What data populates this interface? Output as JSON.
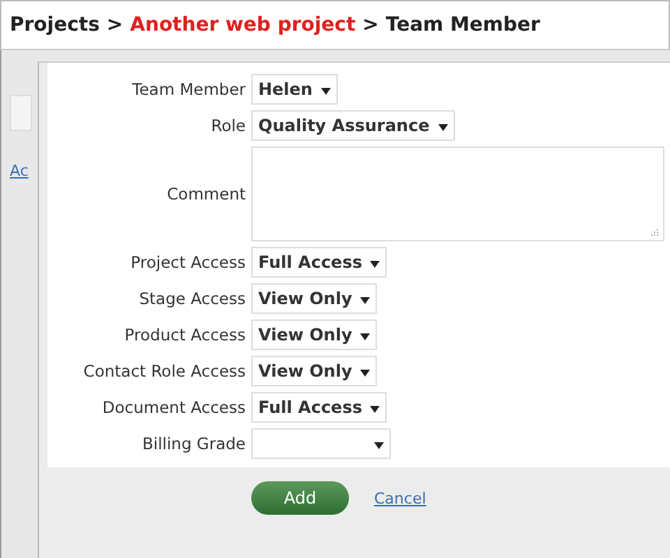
{
  "breadcrumb": [
    {
      "label": "Projects",
      "current": false
    },
    {
      "label": "Another web project",
      "current": true
    },
    {
      "label": "Team Member",
      "current": false
    }
  ],
  "separator": ">",
  "background_link": "Ac",
  "fields": [
    {
      "label": "Team Member",
      "kind": "select",
      "value": "Helen"
    },
    {
      "label": "Role",
      "kind": "select",
      "value": "Quality Assurance"
    },
    {
      "label": "Comment",
      "kind": "textarea"
    },
    {
      "label": "Project Access",
      "kind": "select",
      "value": "Full Access"
    },
    {
      "label": "Stage Access",
      "kind": "select",
      "value": "View Only"
    },
    {
      "label": "Product Access",
      "kind": "select",
      "value": "View Only"
    },
    {
      "label": "Contact Role Access",
      "kind": "select",
      "value": "View Only"
    },
    {
      "label": "Document Access",
      "kind": "select",
      "value": "Full Access"
    },
    {
      "label": "Billing Grade",
      "kind": "select"
    }
  ],
  "buttons": {
    "primary": "Add",
    "cancel": "Cancel"
  }
}
